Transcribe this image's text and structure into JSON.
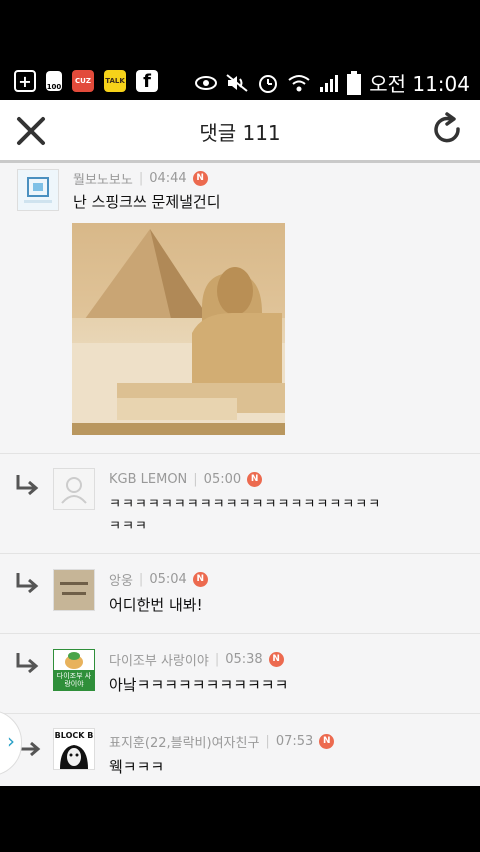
{
  "status_bar": {
    "left_icons": [
      "add-icon",
      "battery-saver-icon",
      "red-app-icon",
      "talk-icon",
      "facebook-icon"
    ],
    "battery_saver_label": "100",
    "facebook_label": "f",
    "talk_label": "TALK",
    "red_app_label": "CUZ",
    "right_icons": [
      "eye-icon",
      "mute-icon",
      "alarm-icon",
      "wifi-icon",
      "signal-icon",
      "battery-icon"
    ],
    "time": "오전 11:04"
  },
  "header": {
    "title": "댓글 111",
    "close_icon": "close-icon",
    "refresh_icon": "refresh-icon"
  },
  "comments": [
    {
      "author": "뭘보노보노",
      "time": "04:44",
      "badge": "N",
      "text": "난 스핑크쓰 문제낼건디",
      "has_image": true
    },
    {
      "author": "KGB LEMON",
      "time": "05:00",
      "badge": "N",
      "text_line1": "ㅋㅋㅋㅋㅋㅋㅋㅋㅋㅋㅋㅋㅋㅋㅋㅋㅋㅋㅋㅋㅋ",
      "text_line2": "ㅋㅋㅋ",
      "is_reply": true
    },
    {
      "author": "앙웅",
      "time": "05:04",
      "badge": "N",
      "text": "어디한번 내봐!",
      "is_reply": true
    },
    {
      "author": "다이조부 사랑이야",
      "time": "05:38",
      "badge": "N",
      "text": "아낰ㅋㅋㅋㅋㅋㅋㅋㅋㅋㅋㅋ",
      "avatar_text": "다이조부 사랑이야",
      "is_reply": true
    },
    {
      "author": "표지훈(22,블락비)여자친구",
      "time": "07:53",
      "badge": "N",
      "text": "웩ㅋㅋㅋ",
      "avatar_text": "BLOCK B",
      "is_reply": true
    }
  ],
  "side_tab_icon": "chevron-right-icon",
  "colors": {
    "badge": "#ec6a4f",
    "accent": "#29a0c7"
  }
}
